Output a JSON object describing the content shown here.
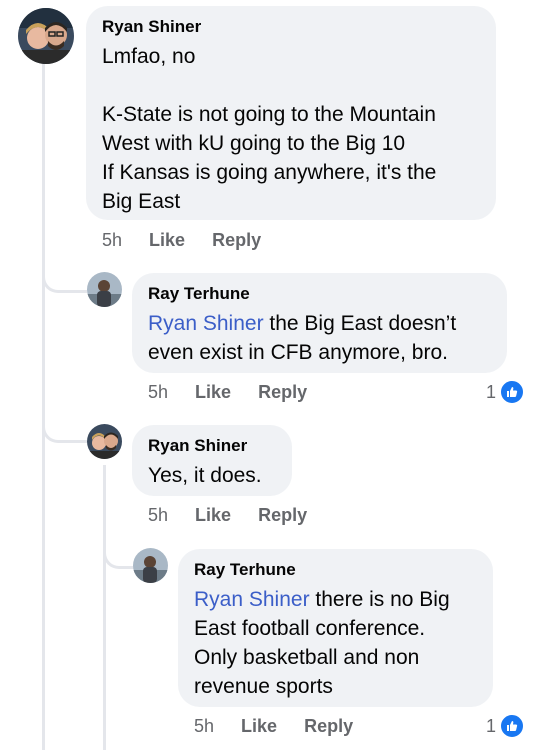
{
  "comments": [
    {
      "author": "Ryan Shiner",
      "lines": [
        "Lmfao, no",
        "",
        "K-State is not going to the Mountain",
        "West with kU going to the Big 10",
        "If Kansas is going anywhere, it's the",
        "Big East"
      ],
      "time": "5h",
      "like": "Like",
      "reply": "Reply"
    },
    {
      "author": "Ray Terhune",
      "mention": "Ryan Shiner",
      "line1_rest": " the Big East doesn’t",
      "line2": "even exist in CFB anymore, bro.",
      "time": "5h",
      "like": "Like",
      "reply": "Reply",
      "reaction_count": "1"
    },
    {
      "author": "Ryan Shiner",
      "line1": "Yes, it does.",
      "time": "5h",
      "like": "Like",
      "reply": "Reply"
    },
    {
      "author": "Ray Terhune",
      "mention": "Ryan Shiner",
      "line1_rest": " there is no Big",
      "line2": "East football conference.",
      "line3": "Only basketball and non",
      "line4": "revenue sports",
      "time": "5h",
      "like": "Like",
      "reply": "Reply",
      "reaction_count": "1"
    }
  ],
  "colors": {
    "bubble": "#f0f2f5",
    "mention": "#3b5ec8",
    "meta": "#65676b",
    "like_badge": "#1877f2"
  }
}
